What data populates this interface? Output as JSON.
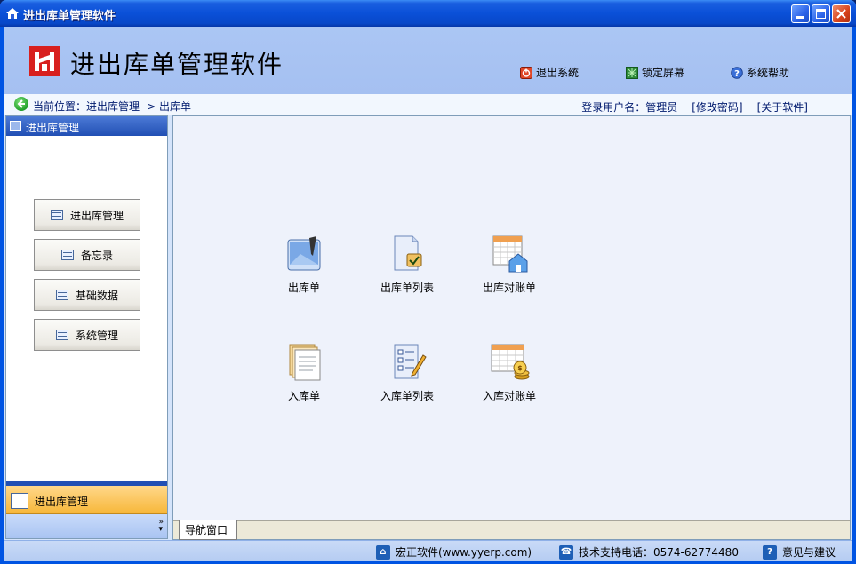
{
  "window": {
    "title": "进出库单管理软件"
  },
  "banner": {
    "app_title": "进出库单管理软件",
    "links": [
      {
        "label": "退出系统",
        "icon": "exit-icon"
      },
      {
        "label": "锁定屏幕",
        "icon": "lock-screen-icon"
      },
      {
        "label": "系统帮助",
        "icon": "help-icon"
      }
    ]
  },
  "pathbar": {
    "location": "当前位置：进出库管理 -> 出库单",
    "user_label": "登录用户名：管理员",
    "change_password": "[修改密码]",
    "about": "[关于软件]"
  },
  "sidebar": {
    "header": "进出库管理",
    "buttons": [
      "进出库管理",
      "备忘录",
      "基础数据",
      "系统管理"
    ],
    "footer_label": "进出库管理"
  },
  "main": {
    "icons": [
      {
        "label": "出库单",
        "icon": "outbound-form-icon"
      },
      {
        "label": "出库单列表",
        "icon": "outbound-list-icon"
      },
      {
        "label": "出库对账单",
        "icon": "outbound-statement-icon"
      },
      {
        "label": "入库单",
        "icon": "inbound-form-icon"
      },
      {
        "label": "入库单列表",
        "icon": "inbound-list-icon"
      },
      {
        "label": "入库对账单",
        "icon": "inbound-statement-icon"
      }
    ],
    "tab": "导航窗口"
  },
  "status": {
    "company": "宏正软件(www.yyerp.com)",
    "phone": "技术支持电话：0574-62774480",
    "feedback": "意见与建议"
  }
}
